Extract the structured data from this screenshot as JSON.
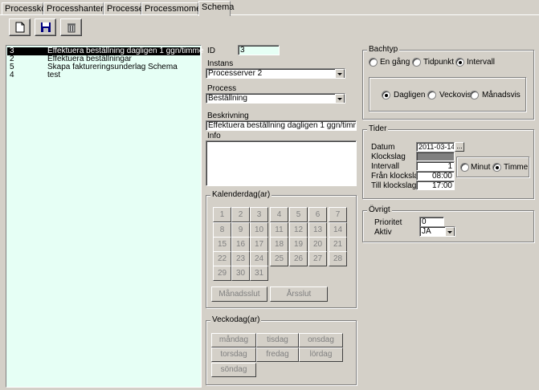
{
  "tabs": [
    "Processkö",
    "Processhanterare",
    "Processer",
    "Processmoment",
    "Schema"
  ],
  "active_tab": "Schema",
  "toolbar": {
    "new_icon": "new-document-icon",
    "save_icon": "save-disk-icon",
    "delete_icon": "trash-icon"
  },
  "list": {
    "rows": [
      {
        "id": "3",
        "name": "Effektuera beställning dagligen 1 ggn/timme"
      },
      {
        "id": "2",
        "name": "Effektuera beställningar"
      },
      {
        "id": "5",
        "name": "Skapa faktureringsunderlag Schema"
      },
      {
        "id": "4",
        "name": "test"
      }
    ]
  },
  "form": {
    "id_label": "ID",
    "id_value": "3",
    "instans_label": "Instans",
    "instans_value": "Processerver 2",
    "process_label": "Process",
    "process_value": "Beställning",
    "beskrivning_label": "Beskrivning",
    "beskrivning_value": "Effektuera beställning dagligen 1 ggn/timme",
    "info_label": "Info",
    "info_value": ""
  },
  "kalender": {
    "title": "Kalenderdag(ar)",
    "days": [
      "1",
      "2",
      "3",
      "4",
      "5",
      "6",
      "7",
      "8",
      "9",
      "10",
      "11",
      "12",
      "13",
      "14",
      "15",
      "16",
      "17",
      "18",
      "19",
      "20",
      "21",
      "22",
      "23",
      "24",
      "25",
      "26",
      "27",
      "28",
      "29",
      "30",
      "31"
    ],
    "month_end": "Månadsslut",
    "year_end": "Årsslut"
  },
  "vecko": {
    "title": "Veckodag(ar)",
    "days": [
      "måndag",
      "tisdag",
      "onsdag",
      "torsdag",
      "fredag",
      "lördag",
      "söndag"
    ]
  },
  "bachtyp": {
    "title": "Bachtyp",
    "options": [
      "En gång",
      "Tidpunkt",
      "Intervall"
    ],
    "selected": "Intervall",
    "sub_options": [
      "Dagligen",
      "Veckovis",
      "Månadsvis"
    ],
    "sub_selected": "Dagligen"
  },
  "tider": {
    "title": "Tider",
    "datum_label": "Datum",
    "datum_value": "2011-03-14",
    "klockslag_label": "Klockslag",
    "klockslag_value": "",
    "intervall_label": "Intervall",
    "intervall_value": "1",
    "fran_label": "Från klockslag",
    "fran_value": "08:00",
    "till_label": "Till klockslag",
    "till_value": "17:00",
    "unit_options": [
      "Minut",
      "Timme"
    ],
    "unit_selected": "Timme",
    "date_button": "..."
  },
  "ovrigt": {
    "title": "Övrigt",
    "prioritet_label": "Prioritet",
    "prioritet_value": "0",
    "aktiv_label": "Aktiv",
    "aktiv_value": "JA"
  }
}
